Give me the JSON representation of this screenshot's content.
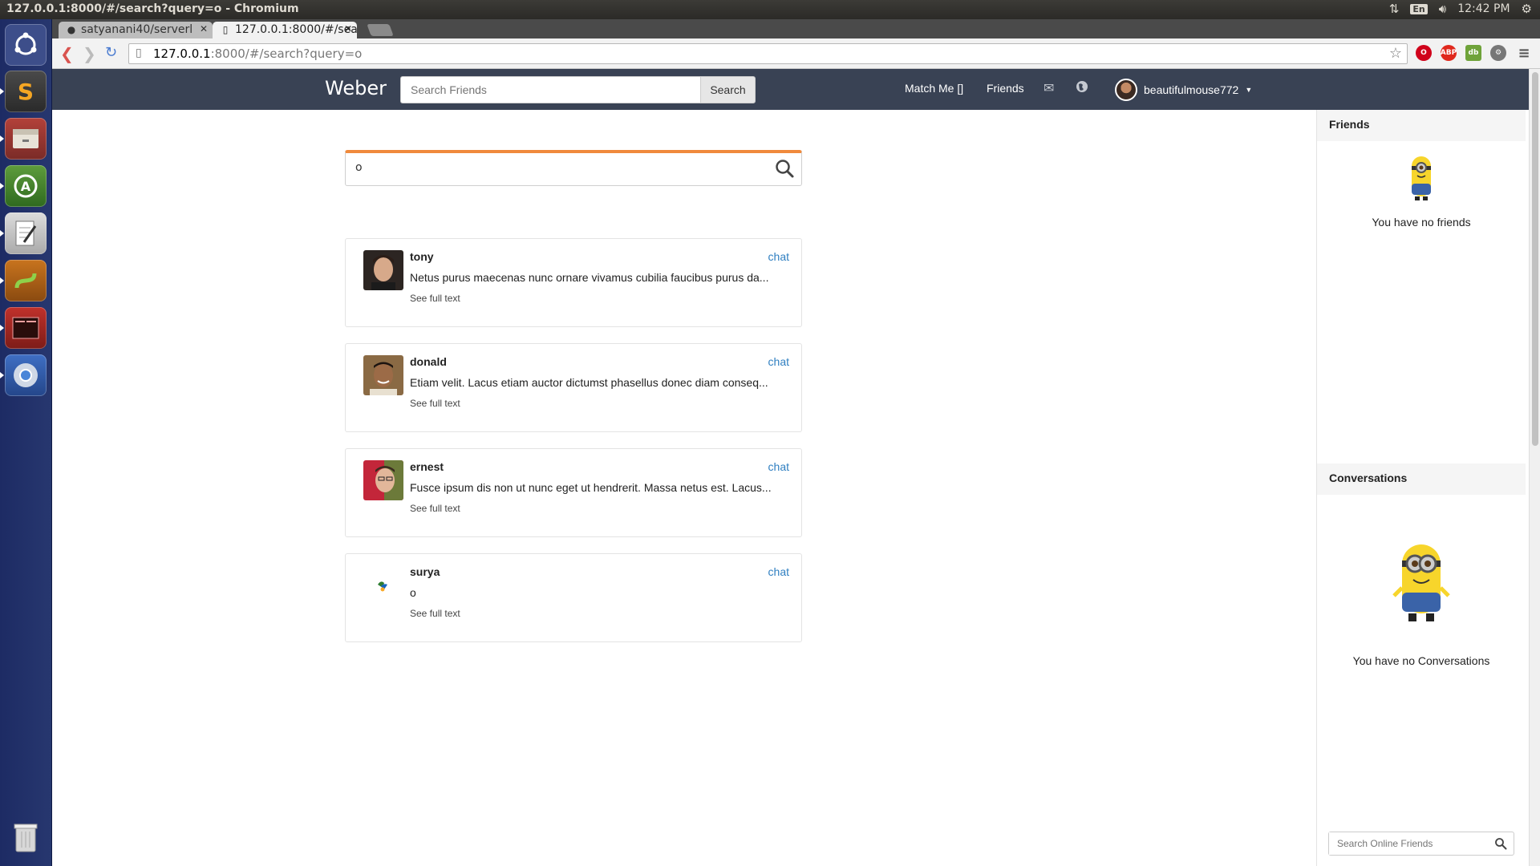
{
  "os": {
    "window_title": "127.0.0.1:8000/#/search?query=o - Chromium",
    "lang": "En",
    "clock": "12:42 PM"
  },
  "browser": {
    "tabs": [
      {
        "title": "satyanani40/serverl",
        "icon": "github-icon"
      },
      {
        "title": "127.0.0.1:8000/#/sea",
        "icon": "page-icon"
      }
    ],
    "url_host": "127.0.0.1",
    "url_rest": ":8000/#/search?query=o"
  },
  "app": {
    "brand": "Weber",
    "nav_search_placeholder": "Search Friends",
    "nav_search_button": "Search",
    "match_me": "Match Me []",
    "friends_link": "Friends",
    "username": "beautifulmouse772"
  },
  "search": {
    "query": "o"
  },
  "results": [
    {
      "name": "tony",
      "chat": "chat",
      "text": "Netus purus maecenas nunc ornare vivamus cubilia faucibus purus da...",
      "more": "See full text"
    },
    {
      "name": "donald",
      "chat": "chat",
      "text": "Etiam velit. Lacus etiam auctor dictumst phasellus donec diam conseq...",
      "more": "See full text"
    },
    {
      "name": "ernest",
      "chat": "chat",
      "text": "Fusce ipsum dis non ut nunc eget ut hendrerit. Massa netus est. Lacus...",
      "more": "See full text"
    },
    {
      "name": "surya",
      "chat": "chat",
      "text": "o",
      "more": "See full text"
    }
  ],
  "sidebar": {
    "friends_title": "Friends",
    "friends_empty": "You have no friends",
    "conversations_title": "Conversations",
    "conversations_empty": "You have no Conversations",
    "online_search_placeholder": "Search Online Friends"
  },
  "colors": {
    "navbar": "#394254",
    "accent_orange": "#f08a3c",
    "link_blue": "#2f7fc1",
    "launcher": "#1d2b64"
  }
}
